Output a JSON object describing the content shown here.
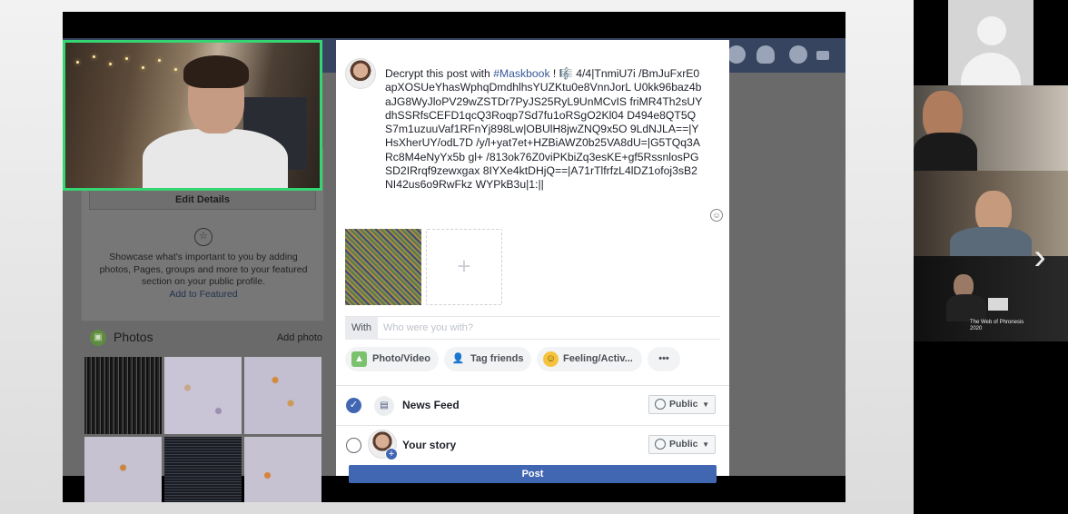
{
  "video": {
    "profile": {
      "edit_details": "Edit Details",
      "showcase_text": "Showcase what's important to you by adding photos, Pages, groups and more to your featured section on your public profile.",
      "showcase_link": "Add to Featured",
      "photos_title": "Photos",
      "add_photo": "Add photo"
    },
    "composer": {
      "post_prefix": "Decrypt this post with ",
      "hashtag": "#Maskbook",
      "post_body": " ! 🎼 4/4|TnmiU7i /BmJuFxrE0apXOSUeYhasWphqDmdhlhsYUZKtu0e8VnnJorL U0kk96baz4baJG8WyJloPV29wZSTDr7PyJS25RyL9UnMCvIS friMR4Th2sUYdhSSRfsCEFD1qcQ3Roqp7Sd7fu1oRSgO2Kl04 D494e8QT5QS7m1uzuuVaf1RFnYj898Lw|OBUlH8jwZNQ9x5O 9LdNJLA==|YHsXherUY/odL7D /y/l+yat7et+HZBiAWZ0b25VA8dU=|G5TQq3ARc8M4eNyYx5b gl+ /813ok76Z0viPKbiZq3esKE+gf5RssnlosPGSD2IRrqf9zewxgax 8IYXe4ktDHjQ==|A71rTlfrfzL4lDZ1ofoj3sB2NI42us6o9RwFkz WYPkB3u|1:||",
      "with_label": "With",
      "with_placeholder": "Who were you with?",
      "actions": [
        {
          "label": "Photo/Video",
          "icon": "photo-icon"
        },
        {
          "label": "Tag friends",
          "icon": "tag-friends-icon"
        },
        {
          "label": "Feeling/Activ...",
          "icon": "smiley-icon"
        },
        {
          "label": "•••",
          "icon": "more-icon"
        }
      ],
      "audiences": [
        {
          "label": "News Feed",
          "visibility": "Public",
          "checked": true
        },
        {
          "label": "Your story",
          "visibility": "Public",
          "checked": false
        }
      ],
      "post_button": "Post"
    }
  },
  "sidebar": {
    "conference_caption": "The Web of Phronesis 2020"
  },
  "colors": {
    "facebook_blue": "#4267b2",
    "camera_border": "#33d670"
  }
}
